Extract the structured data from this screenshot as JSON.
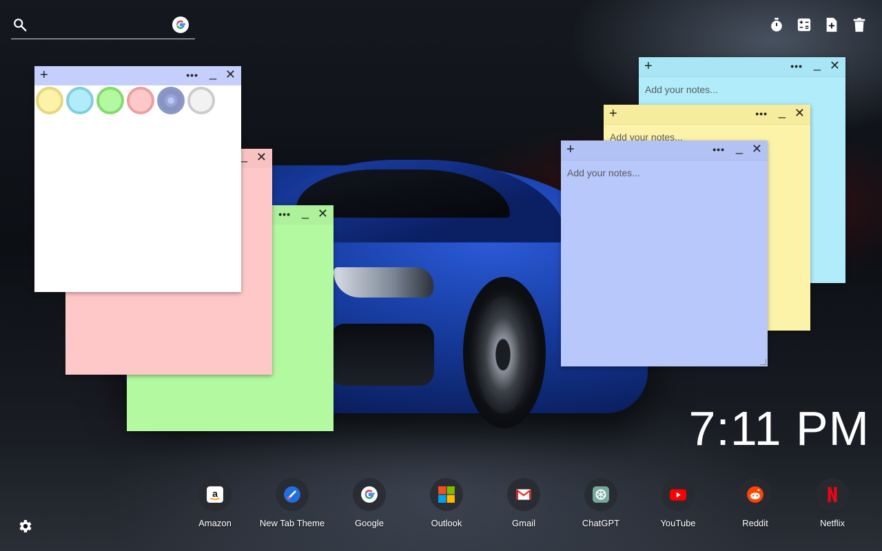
{
  "search": {
    "placeholder": "",
    "value": "",
    "engine_icon": "google-icon"
  },
  "toolbar": {
    "items": [
      {
        "icon": "timer-icon"
      },
      {
        "icon": "calculator-icon"
      },
      {
        "icon": "new-note-icon"
      },
      {
        "icon": "trash-icon"
      }
    ]
  },
  "notes": {
    "add_label": "+",
    "more_label": "•••",
    "minimize_label": "_",
    "close_label": "✕",
    "placeholder": "Add your notes...",
    "colors": {
      "white": "#ffffff",
      "pink": "#ffc8c8",
      "green": "#b2f9a0",
      "blue": "#b9c8fa",
      "yellow": "#fdf3a8",
      "cyan": "#b0ecfa"
    },
    "palette": [
      {
        "name": "yellow",
        "fill": "#fdf3a8",
        "ring": "#e6d77a"
      },
      {
        "name": "cyan",
        "fill": "#b0ecfa",
        "ring": "#84cde0"
      },
      {
        "name": "green",
        "fill": "#b2f9a0",
        "ring": "#86d872"
      },
      {
        "name": "pink",
        "fill": "#ffc8c8",
        "ring": "#e9a0a0"
      },
      {
        "name": "blue",
        "fill": "#b9c8fa",
        "ring": "#8a98c8",
        "selected": true
      },
      {
        "name": "white",
        "fill": "#f2f2f2",
        "ring": "#cccccc"
      }
    ]
  },
  "clock": {
    "time": "7:11 PM"
  },
  "dock": {
    "items": [
      {
        "label": "Amazon",
        "icon": "amazon-icon"
      },
      {
        "label": "New Tab Theme",
        "icon": "new-tab-theme-icon"
      },
      {
        "label": "Google",
        "icon": "google-icon"
      },
      {
        "label": "Outlook",
        "icon": "outlook-icon"
      },
      {
        "label": "Gmail",
        "icon": "gmail-icon"
      },
      {
        "label": "ChatGPT",
        "icon": "chatgpt-icon"
      },
      {
        "label": "YouTube",
        "icon": "youtube-icon"
      },
      {
        "label": "Reddit",
        "icon": "reddit-icon"
      },
      {
        "label": "Netflix",
        "icon": "netflix-icon"
      }
    ]
  },
  "settings": {
    "icon": "gear-icon"
  }
}
